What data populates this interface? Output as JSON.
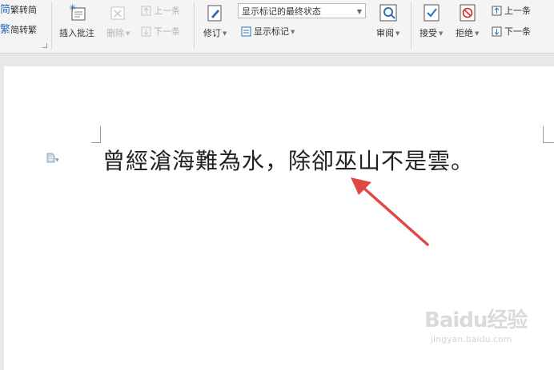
{
  "ribbon": {
    "trad_to_simp": "繁转简",
    "simp_to_trad": "简转繁",
    "insert_comment": "插入批注",
    "delete": "删除",
    "prev_comment": "上一条",
    "next_comment": "下一条",
    "track_changes": "修订",
    "display_mode": "显示标记的最终状态",
    "show_markup": "显示标记",
    "review": "审阅",
    "accept": "接受",
    "reject": "拒绝",
    "prev_change": "上一条",
    "next_change": "下一条",
    "glyph_jian": "简",
    "glyph_fan": "繁"
  },
  "document": {
    "text": "曾經滄海難為水，除卻巫山不是雲。"
  },
  "watermark": {
    "main": "Baidu经验",
    "sub": "jingyan.baidu.com"
  },
  "colors": {
    "accent_blue": "#2b6fb6",
    "reject_red": "#d9262b",
    "arrow_red": "#e04848"
  }
}
